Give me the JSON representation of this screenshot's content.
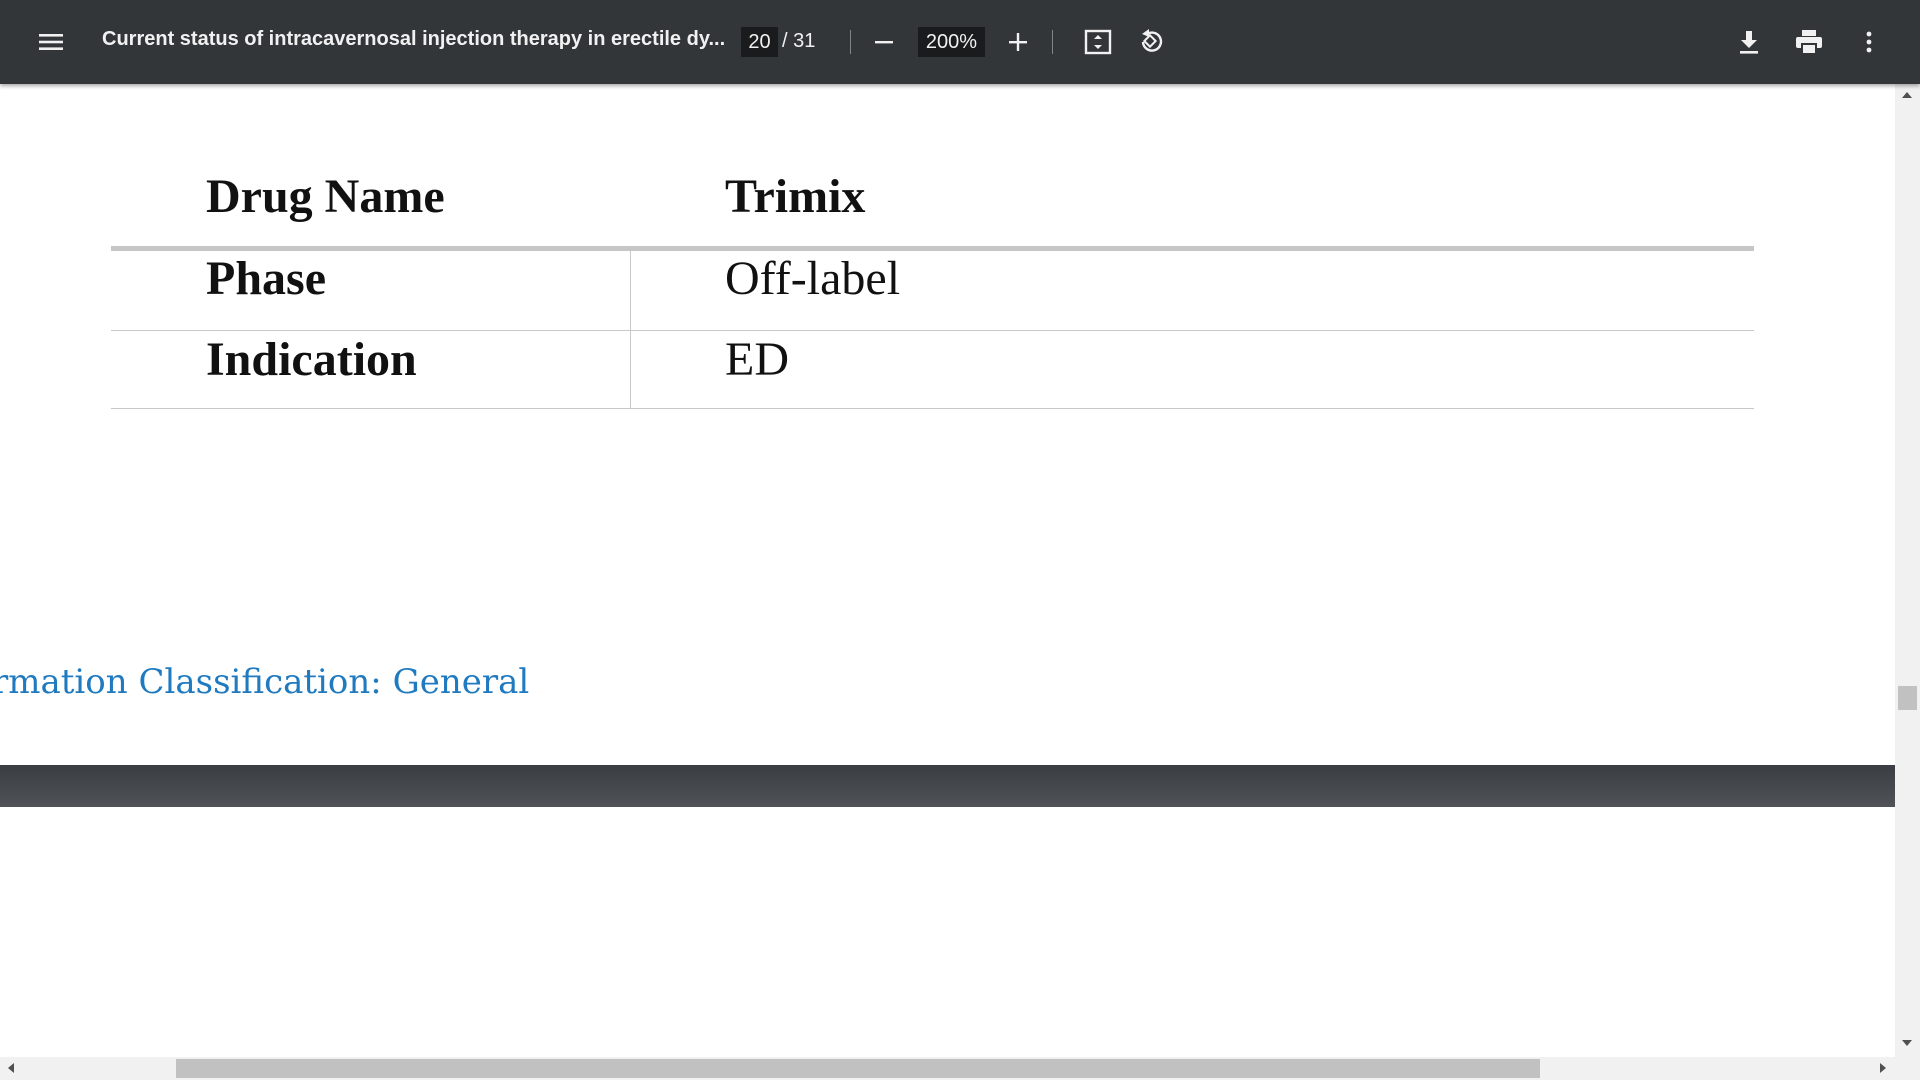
{
  "toolbar": {
    "menu_icon": "hamburger-menu-icon",
    "title": "Current status of intracavernosal injection therapy in erectile dy...",
    "page_current": "20",
    "page_total": "/ 31",
    "zoom": "200%",
    "icons": [
      "minus-icon",
      "plus-icon",
      "fit-page-icon",
      "rotate-icon",
      "download-icon",
      "print-icon",
      "more-vert-icon"
    ]
  },
  "table": {
    "header": {
      "label": "Drug Name",
      "value": "Trimix"
    },
    "rows": [
      {
        "label": "Phase",
        "value": "Off-label"
      },
      {
        "label": "Indication",
        "value": "ED"
      }
    ]
  },
  "footer": {
    "classification": "rmation Classification: General"
  },
  "colors": {
    "toolbar_bg": "#323639",
    "footer_text": "#1f7ac0"
  }
}
